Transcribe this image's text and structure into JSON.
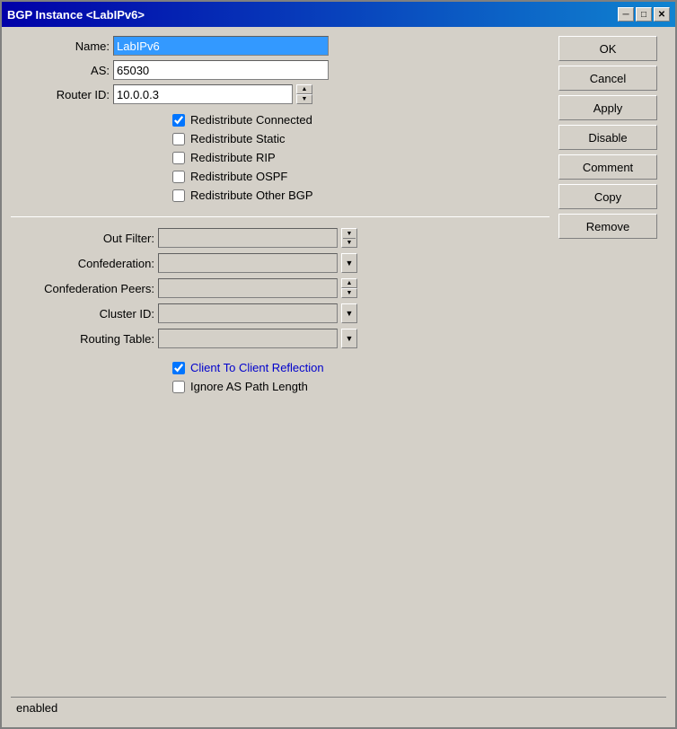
{
  "window": {
    "title": "BGP Instance <LabIPv6>",
    "minimize_label": "─",
    "maximize_label": "□",
    "close_label": "✕"
  },
  "fields": {
    "name_label": "Name:",
    "name_value": "LabIPv6",
    "as_label": "AS:",
    "as_value": "65030",
    "router_id_label": "Router ID:",
    "router_id_value": "10.0.0.3"
  },
  "checkboxes": [
    {
      "id": "chk_conn",
      "label": "Redistribute Connected",
      "checked": true
    },
    {
      "id": "chk_static",
      "label": "Redistribute Static",
      "checked": false
    },
    {
      "id": "chk_rip",
      "label": "Redistribute RIP",
      "checked": false
    },
    {
      "id": "chk_ospf",
      "label": "Redistribute OSPF",
      "checked": false
    },
    {
      "id": "chk_bgp",
      "label": "Redistribute Other BGP",
      "checked": false
    }
  ],
  "combos": [
    {
      "id": "out_filter",
      "label": "Out Filter:",
      "value": "",
      "type": "filter"
    },
    {
      "id": "confederation",
      "label": "Confederation:",
      "value": "",
      "type": "down"
    },
    {
      "id": "conf_peers",
      "label": "Confederation Peers:",
      "value": "",
      "type": "spin"
    },
    {
      "id": "cluster_id",
      "label": "Cluster ID:",
      "value": "",
      "type": "down"
    },
    {
      "id": "routing_table",
      "label": "Routing Table:",
      "value": "",
      "type": "down"
    }
  ],
  "bottom_checkboxes": [
    {
      "id": "chk_client",
      "label": "Client To Client Reflection",
      "checked": true
    },
    {
      "id": "chk_ignore",
      "label": "Ignore AS Path Length",
      "checked": false
    }
  ],
  "buttons": {
    "ok": "OK",
    "cancel": "Cancel",
    "apply": "Apply",
    "disable": "Disable",
    "comment": "Comment",
    "copy": "Copy",
    "remove": "Remove"
  },
  "status_bar": {
    "text": "enabled"
  }
}
